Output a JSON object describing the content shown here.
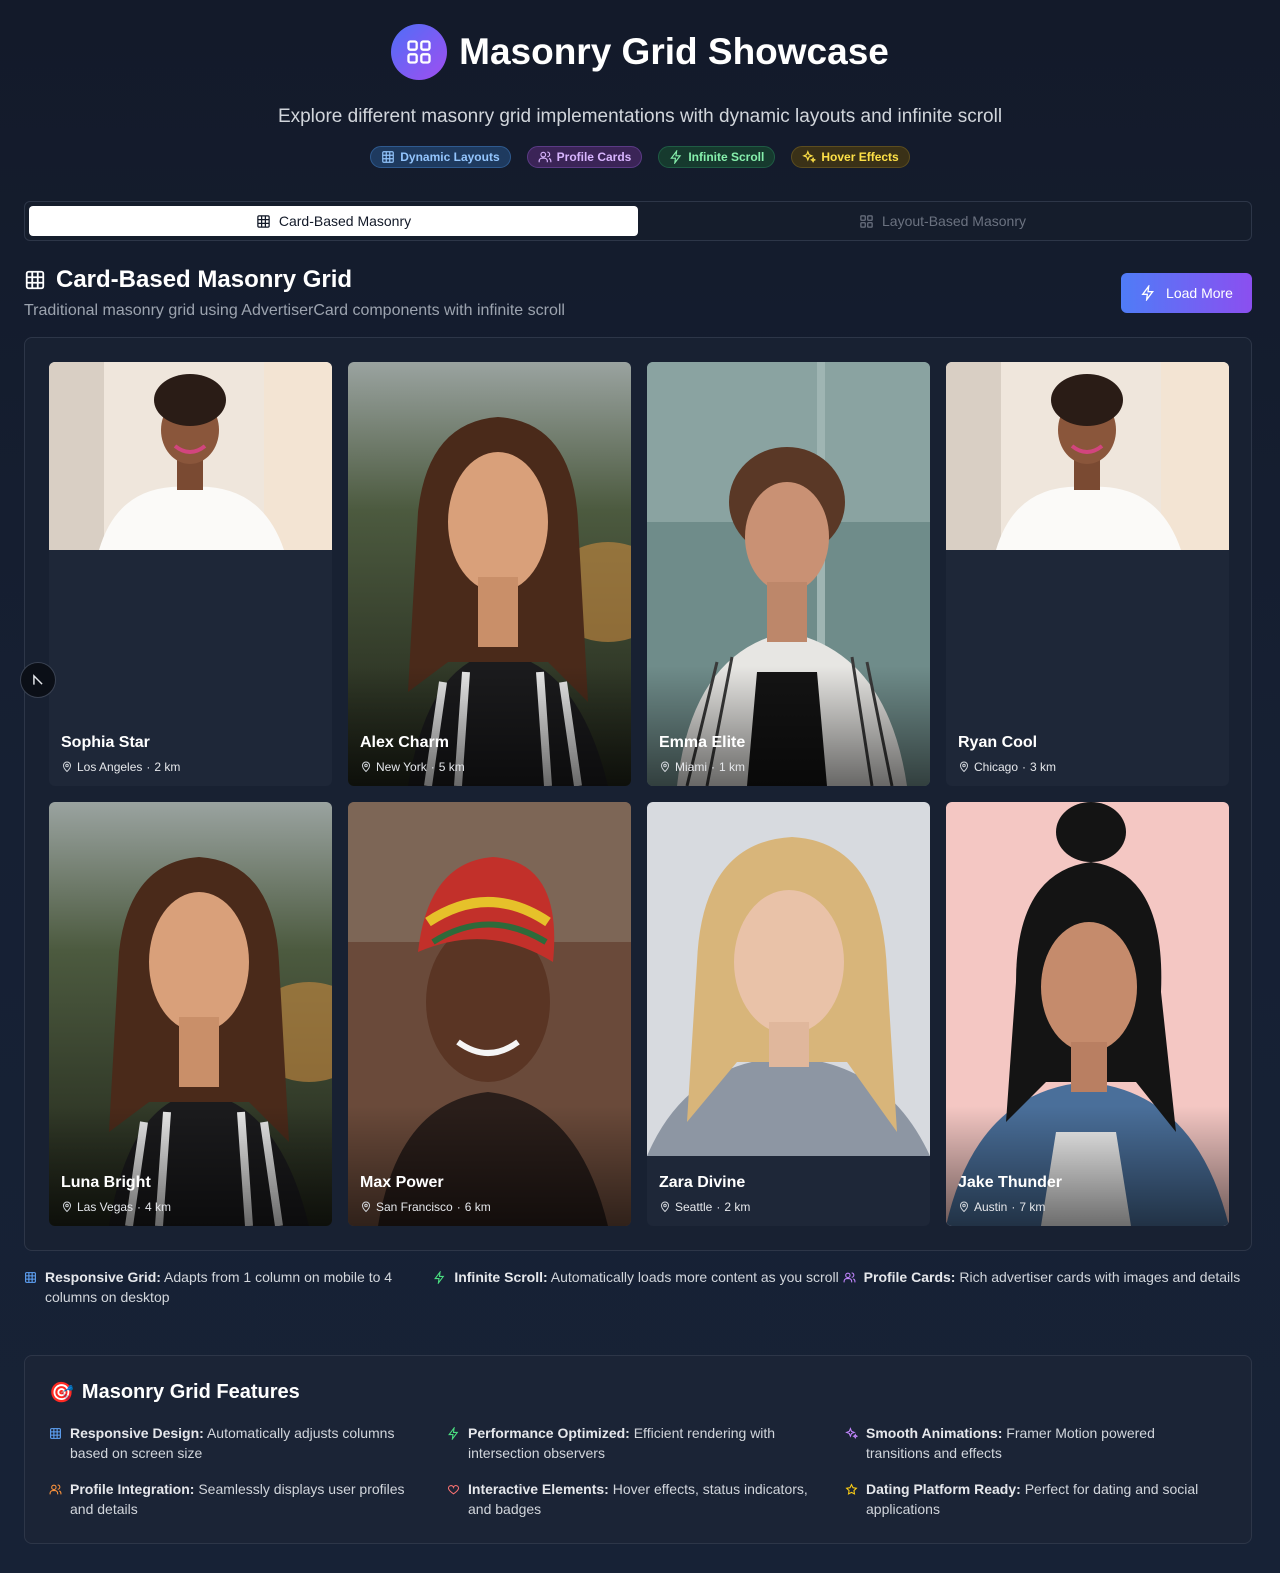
{
  "header": {
    "title": "Masonry Grid Showcase",
    "subtitle": "Explore different masonry grid implementations with dynamic layouts and infinite scroll",
    "logo_icon": "grid-icon",
    "badges": [
      {
        "label": "Dynamic Layouts",
        "icon": "grid-icon",
        "color": "#93c5fd"
      },
      {
        "label": "Profile Cards",
        "icon": "users-icon",
        "color": "#d8b4fe"
      },
      {
        "label": "Infinite Scroll",
        "icon": "lightning-icon",
        "color": "#86efac"
      },
      {
        "label": "Hover Effects",
        "icon": "sparkles-icon",
        "color": "#fde047"
      }
    ]
  },
  "tabs": [
    {
      "label": "Card-Based Masonry",
      "active": true
    },
    {
      "label": "Layout-Based Masonry",
      "active": false
    }
  ],
  "section": {
    "title": "Card-Based Masonry Grid",
    "subtitle": "Traditional masonry grid using AdvertiserCard components with infinite scroll",
    "load_more": "Load More"
  },
  "cards": [
    {
      "name": "Sophia Star",
      "location": "Los Angeles",
      "distance": "2 km"
    },
    {
      "name": "Alex Charm",
      "location": "New York",
      "distance": "5 km"
    },
    {
      "name": "Emma Elite",
      "location": "Miami",
      "distance": "1 km"
    },
    {
      "name": "Ryan Cool",
      "location": "Chicago",
      "distance": "3 km"
    },
    {
      "name": "Luna Bright",
      "location": "Las Vegas",
      "distance": "4 km"
    },
    {
      "name": "Max Power",
      "location": "San Francisco",
      "distance": "6 km"
    },
    {
      "name": "Zara Divine",
      "location": "Seattle",
      "distance": "2 km"
    },
    {
      "name": "Jake Thunder",
      "location": "Austin",
      "distance": "7 km"
    }
  ],
  "notes": [
    {
      "bold": "Responsive Grid:",
      "text": " Adapts from 1 column on mobile to 4 columns on desktop"
    },
    {
      "bold": "Infinite Scroll:",
      "text": " Automatically loads more content as you scroll"
    },
    {
      "bold": "Profile Cards:",
      "text": " Rich advertiser cards with images and details"
    }
  ],
  "features": {
    "title": "Masonry Grid Features",
    "title_emoji": "🎯",
    "items": [
      {
        "bold": "Responsive Design:",
        "text": " Automatically adjusts columns based on screen size"
      },
      {
        "bold": "Performance Optimized:",
        "text": " Efficient rendering with intersection observers"
      },
      {
        "bold": "Smooth Animations:",
        "text": " Framer Motion powered transitions and effects"
      },
      {
        "bold": "Profile Integration:",
        "text": " Seamlessly displays user profiles and details"
      },
      {
        "bold": "Interactive Elements:",
        "text": " Hover effects, status indicators, and badges"
      },
      {
        "bold": "Dating Platform Ready:",
        "text": " Perfect for dating and social applications"
      }
    ]
  }
}
